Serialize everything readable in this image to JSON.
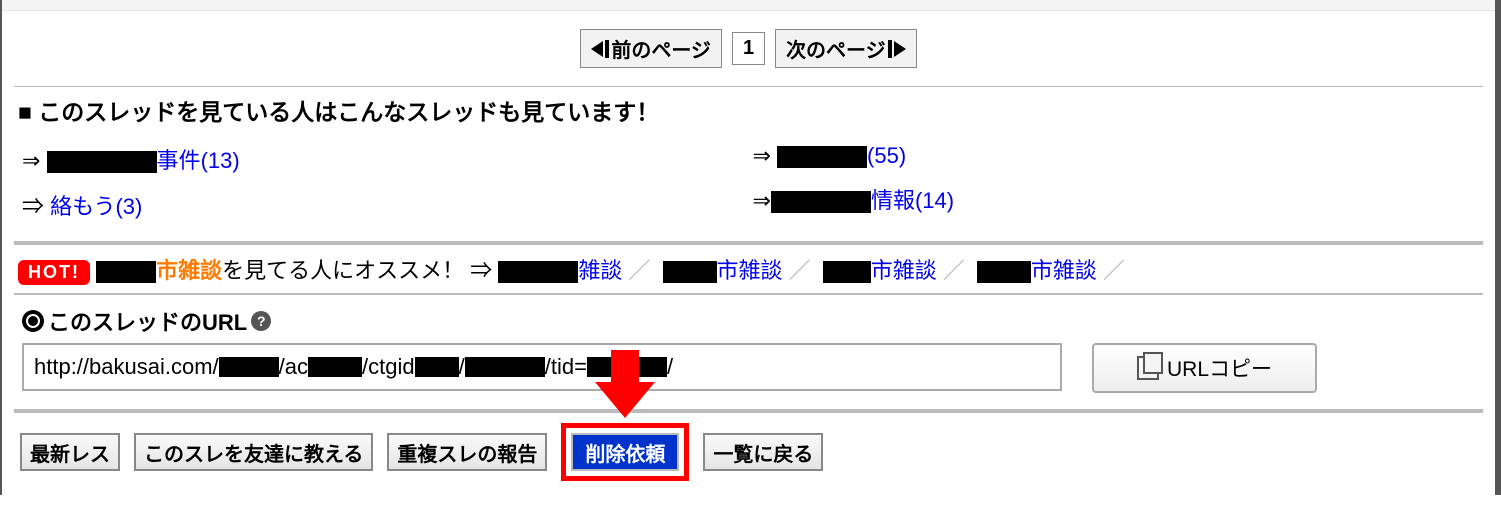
{
  "pager": {
    "prev_label": "前のページ",
    "next_label": "次のページ",
    "page": "1"
  },
  "related": {
    "heading": "■ このスレッドを見ている人はこんなスレッドも見ています！",
    "items": [
      {
        "pre": "",
        "suf": "事件",
        "count": "13"
      },
      {
        "pre": "",
        "suf": "",
        "count": "55"
      },
      {
        "pre": "絡もう",
        "suf": "",
        "count": "3"
      },
      {
        "pre": "",
        "suf": "情報",
        "count": "14"
      }
    ]
  },
  "hot": {
    "badge": "HOT!",
    "topic_suffix": "市雑談",
    "rec_label": "を見てる人にオススメ！ ⇒",
    "links": [
      {
        "suf": "雑談"
      },
      {
        "suf": "市雑談"
      },
      {
        "suf": "市雑談"
      },
      {
        "suf": "市雑談"
      }
    ]
  },
  "url": {
    "label": "このスレッドのURL",
    "help": "?",
    "prefix": "http://bakusai.com/",
    "seg_ac": "/ac",
    "seg_ctgid": "/ctgid",
    "seg_slash": "/",
    "seg_tid": "/tid=",
    "seg_end": "/",
    "copy_label": "URLコピー"
  },
  "footer": {
    "latest": "最新レス",
    "share": "このスレを友達に教える",
    "dup": "重複スレの報告",
    "delete": "削除依頼",
    "back": "一覧に戻る"
  }
}
